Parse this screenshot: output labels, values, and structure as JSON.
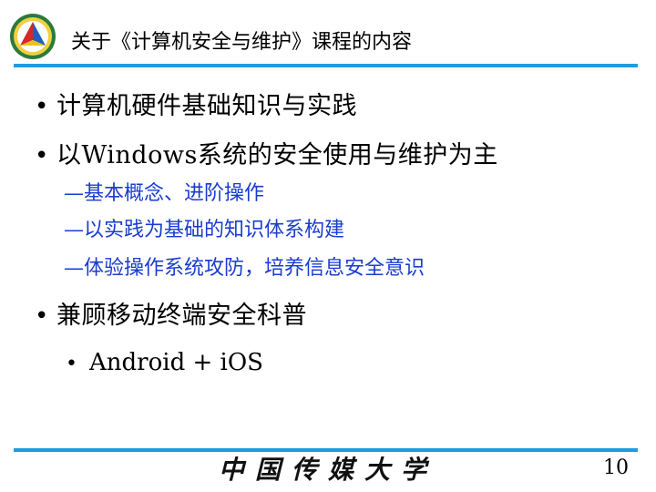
{
  "header": {
    "title": "关于《计算机安全与维护》课程的内容",
    "logo": {
      "icon": "university-emblem-icon",
      "colors": {
        "ring_outer": "#2c7a3b",
        "ring_inner": "#f0d040",
        "triangle_left": "#d62828",
        "triangle_right": "#1f5fbf",
        "triangle_top": "#e8c21a"
      }
    }
  },
  "bullets": [
    {
      "text": "计算机硬件基础知识与实践"
    },
    {
      "text": "以Windows系统的安全使用与维护为主",
      "subitems": [
        "—基本概念、进阶操作",
        "—以实践为基础的知识体系构建",
        "—体验操作系统攻防，培养信息安全意识"
      ]
    },
    {
      "text": "兼顾移动终端安全科普",
      "subbullets": [
        "Android + iOS"
      ]
    }
  ],
  "footer": {
    "calligraphy_text": "中国传媒大学",
    "page_number": "10"
  },
  "colors": {
    "rule": "#1e9ce0",
    "subitem_text": "#1a3ccf",
    "body_text": "#000000"
  }
}
